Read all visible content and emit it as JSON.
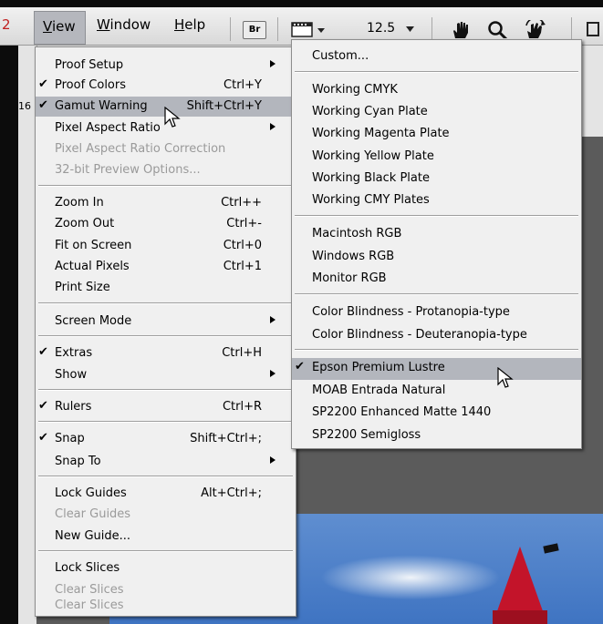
{
  "menubar": {
    "partial_left": "2",
    "items": [
      {
        "label": "View",
        "underline": "V",
        "rest": "iew"
      },
      {
        "label": "Window",
        "underline": "W",
        "rest": "indow"
      },
      {
        "label": "Help",
        "underline": "H",
        "rest": "elp"
      }
    ],
    "bridge_label": "Br",
    "zoom_value": "12.5"
  },
  "document": {
    "ruler_number": "16"
  },
  "view_menu": {
    "items": [
      {
        "label": "Proof Setup",
        "shortcut": "",
        "submenu": true
      },
      {
        "label": "Proof Colors",
        "shortcut": "Ctrl+Y",
        "checked": true
      },
      {
        "label": "Gamut Warning",
        "shortcut": "Shift+Ctrl+Y",
        "checked": true,
        "highlighted": true
      },
      {
        "label": "Pixel Aspect Ratio",
        "shortcut": "",
        "submenu": true
      },
      {
        "label": "Pixel Aspect Ratio Correction",
        "shortcut": "",
        "disabled": true
      },
      {
        "label": "32-bit Preview Options...",
        "shortcut": "",
        "disabled": true
      },
      {
        "label": "Zoom In",
        "shortcut": "Ctrl++"
      },
      {
        "label": "Zoom Out",
        "shortcut": "Ctrl+-"
      },
      {
        "label": "Fit on Screen",
        "shortcut": "Ctrl+0"
      },
      {
        "label": "Actual Pixels",
        "shortcut": "Ctrl+1"
      },
      {
        "label": "Print Size",
        "shortcut": ""
      },
      {
        "label": "Screen Mode",
        "shortcut": "",
        "submenu": true
      },
      {
        "label": "Extras",
        "shortcut": "Ctrl+H",
        "checked": true
      },
      {
        "label": "Show",
        "shortcut": "",
        "submenu": true
      },
      {
        "label": "Rulers",
        "shortcut": "Ctrl+R",
        "checked": true
      },
      {
        "label": "Snap",
        "shortcut": "Shift+Ctrl+;",
        "checked": true
      },
      {
        "label": "Snap To",
        "shortcut": "",
        "submenu": true
      },
      {
        "label": "Lock Guides",
        "shortcut": "Alt+Ctrl+;"
      },
      {
        "label": "Clear Guides",
        "shortcut": "",
        "disabled": true
      },
      {
        "label": "New Guide...",
        "shortcut": ""
      },
      {
        "label": "Lock Slices",
        "shortcut": ""
      },
      {
        "label": "Clear Slices",
        "shortcut": "",
        "disabled": true
      },
      {
        "label": "Clear Slices",
        "shortcut": "",
        "disabled": true
      }
    ]
  },
  "proof_setup_submenu": {
    "items": [
      {
        "label": "Custom..."
      },
      {
        "label": "Working CMYK"
      },
      {
        "label": "Working Cyan Plate"
      },
      {
        "label": "Working Magenta Plate"
      },
      {
        "label": "Working Yellow Plate"
      },
      {
        "label": "Working Black Plate"
      },
      {
        "label": "Working CMY Plates"
      },
      {
        "label": "Macintosh RGB"
      },
      {
        "label": "Windows RGB"
      },
      {
        "label": "Monitor RGB"
      },
      {
        "label": "Color Blindness - Protanopia-type"
      },
      {
        "label": "Color Blindness - Deuteranopia-type"
      },
      {
        "label": "Epson Premium Lustre",
        "checked": true,
        "highlighted": true
      },
      {
        "label": "MOAB Entrada Natural"
      },
      {
        "label": "SP2200 Enhanced Matte 1440"
      },
      {
        "label": "SP2200 Semigloss"
      }
    ]
  },
  "colors": {
    "highlight": "#b3b6bd",
    "menu_bg": "#f0f0f0",
    "disabled_text": "#9a9a9a",
    "tower_red": "#c3142a"
  },
  "icons": [
    "screen-mode-icon",
    "hand-tool-icon",
    "zoom-tool-icon",
    "rotate-view-icon",
    "checkmark-icon",
    "submenu-arrow-icon",
    "mouse-cursor-icon"
  ]
}
